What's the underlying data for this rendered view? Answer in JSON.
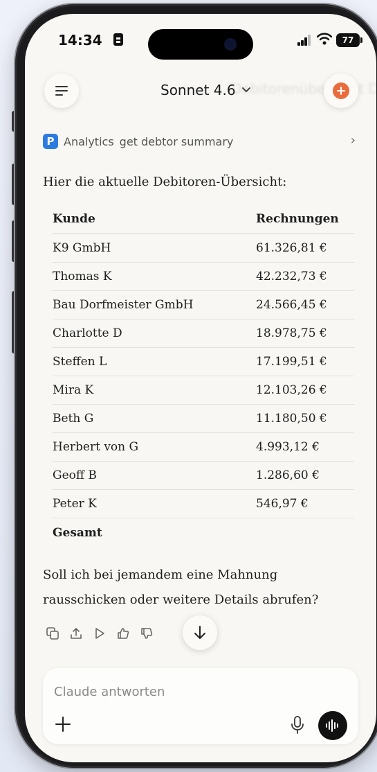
{
  "status_bar": {
    "time": "14:34",
    "battery": "77"
  },
  "header": {
    "model": "Sonnet 4.6",
    "background_title": "Debitorenübersicht Debitoren"
  },
  "tool_call": {
    "app": "Analytics",
    "name": "get debtor summary"
  },
  "message": {
    "intro": "Hier die aktuelle Debitoren-Übersicht:",
    "table": {
      "headers": [
        "Kunde",
        "Rechnungen"
      ],
      "rows": [
        [
          "K9 GmbH",
          "61.326,81 €"
        ],
        [
          "Thomas K",
          "42.232,73 €"
        ],
        [
          "Bau Dorfmeister GmbH",
          "24.566,45 €"
        ],
        [
          "Charlotte D",
          "18.978,75 €"
        ],
        [
          "Steffen L",
          "17.199,51 €"
        ],
        [
          "Mira K",
          "12.103,26 €"
        ],
        [
          "Beth G",
          "11.180,50 €"
        ],
        [
          "Herbert von G",
          "4.993,12 €"
        ],
        [
          "Geoff B",
          "1.286,60 €"
        ],
        [
          "Peter K",
          "546,97 €"
        ]
      ],
      "total_label": "Gesamt"
    },
    "closing_line1": "Soll ich bei jemandem eine Mahnung",
    "closing_line2": "rausschicken oder weitere Details abrufen?"
  },
  "composer": {
    "placeholder": "Claude antworten"
  },
  "colors": {
    "accent": "#ea6c3c",
    "tool_logo": "#2b7be0",
    "screen_bg": "#f8f7f3"
  },
  "icons": [
    "menu-icon",
    "new-chat-icon",
    "chevron-down-icon",
    "chevron-right-icon",
    "copy-icon",
    "share-icon",
    "play-icon",
    "thumbs-up-icon",
    "thumbs-down-icon",
    "arrow-down-icon",
    "plus-icon",
    "microphone-icon",
    "voice-waveform-icon"
  ]
}
